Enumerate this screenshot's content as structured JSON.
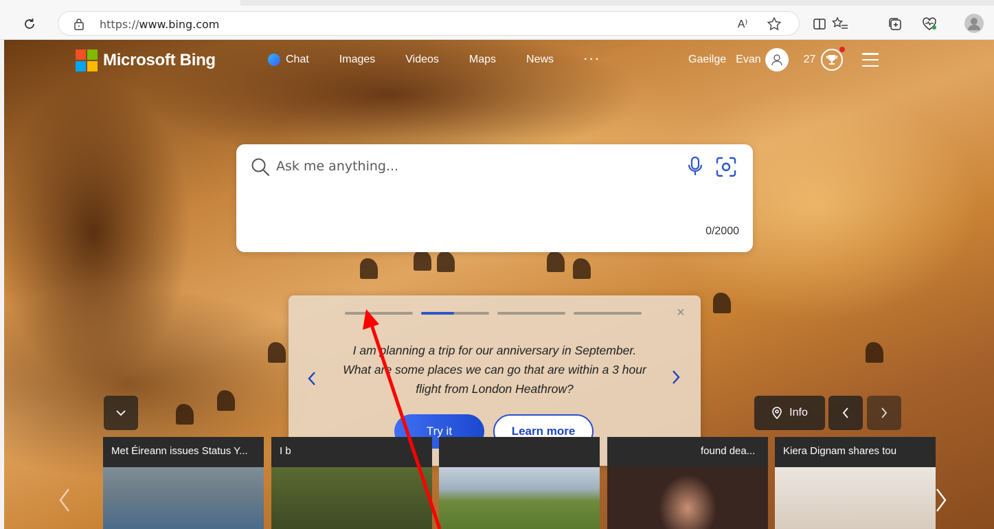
{
  "browser": {
    "url_protocol": "https://",
    "url_host": "www.bing.com",
    "read_aloud_label": "A⁾"
  },
  "header": {
    "brand": "Microsoft Bing",
    "nav": {
      "chat": "Chat",
      "images": "Images",
      "videos": "Videos",
      "maps": "Maps",
      "news": "News",
      "more": "···"
    },
    "language": "Gaeilge",
    "user_name": "Evan",
    "points": "27"
  },
  "search": {
    "placeholder": "Ask me anything...",
    "char_count": "0/2000"
  },
  "prompt_card": {
    "text": "I am planning a trip for our anniversary in September. What are some places we can go that are within a 3 hour flight from London Heathrow?",
    "try_label": "Try it",
    "learn_label": "Learn more",
    "close_symbol": "×",
    "active_step": 2,
    "total_steps": 4,
    "active_progress": 0.48
  },
  "controls": {
    "info_label": "Info"
  },
  "news": [
    {
      "headline": "Met Éireann issues Status Y...",
      "thumb_colors": [
        "#8a9aa8",
        "#5f6f7c"
      ]
    },
    {
      "headline": "I b",
      "thumb_colors": [
        "#6a7a3a",
        "#4b5a2a"
      ]
    },
    {
      "headline": "",
      "thumb_colors": [
        "#b7c4cf",
        "#6f8a3c"
      ]
    },
    {
      "headline": "found dea...",
      "thumb_colors": [
        "#3a2620",
        "#1e1410"
      ]
    },
    {
      "headline": "Kiera Dignam shares tou",
      "thumb_colors": [
        "#e8e0d8",
        "#c8b8a8"
      ]
    }
  ],
  "colors": {
    "accent_blue": "#2d56c9",
    "annotation_red": "#ff0000"
  }
}
